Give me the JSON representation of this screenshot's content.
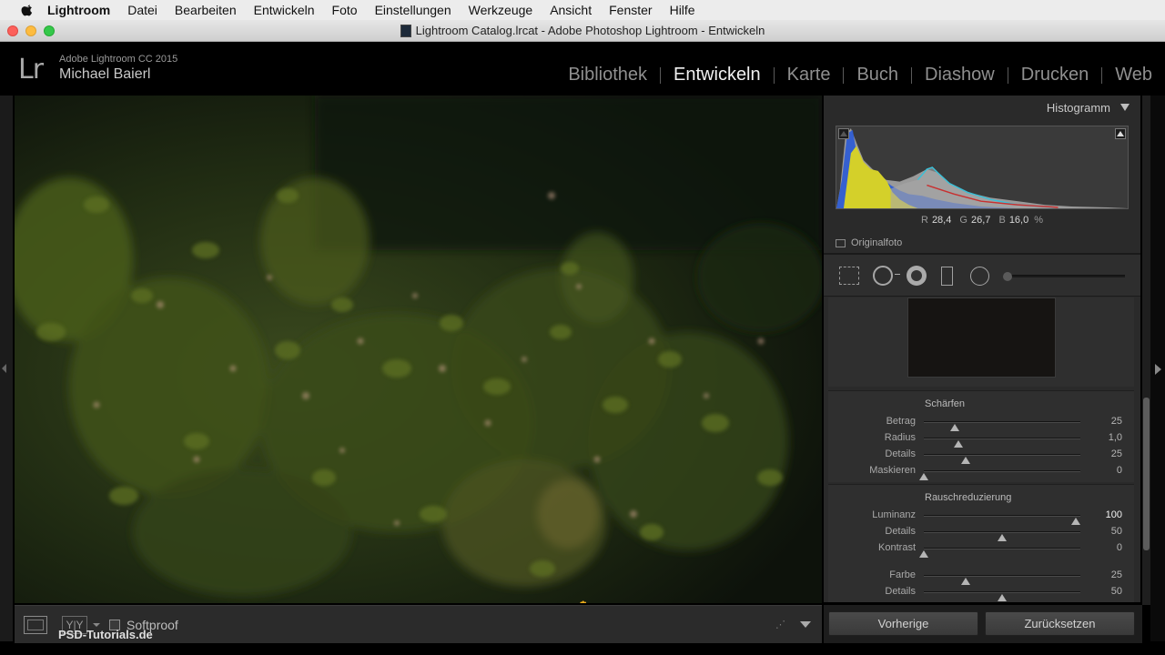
{
  "menubar": {
    "app": "Lightroom",
    "items": [
      "Datei",
      "Bearbeiten",
      "Entwickeln",
      "Foto",
      "Einstellungen",
      "Werkzeuge",
      "Ansicht",
      "Fenster",
      "Hilfe"
    ]
  },
  "window": {
    "title": "Lightroom Catalog.lrcat - Adobe Photoshop Lightroom - Entwickeln"
  },
  "identity": {
    "logo": "Lr",
    "product": "Adobe Lightroom CC 2015",
    "user": "Michael Baierl"
  },
  "modules": {
    "items": [
      "Bibliothek",
      "Entwickeln",
      "Karte",
      "Buch",
      "Diashow",
      "Drucken",
      "Web"
    ],
    "active": "Entwickeln"
  },
  "histogram": {
    "title": "Histogramm",
    "r_label": "R",
    "r_value": "28,4",
    "g_label": "G",
    "g_value": "26,7",
    "b_label": "B",
    "b_value": "16,0",
    "unit": "%",
    "original_label": "Originalfoto"
  },
  "sharpen": {
    "title": "Schärfen",
    "rows": [
      {
        "label": "Betrag",
        "value": "25",
        "pos": 0.2
      },
      {
        "label": "Radius",
        "value": "1,0",
        "pos": 0.22
      },
      {
        "label": "Details",
        "value": "25",
        "pos": 0.27
      },
      {
        "label": "Maskieren",
        "value": "0",
        "pos": 0.0
      }
    ]
  },
  "noise": {
    "title": "Rauschreduzierung",
    "rows": [
      {
        "label": "Luminanz",
        "value": "100",
        "pos": 0.97,
        "highlight": true
      },
      {
        "label": "Details",
        "value": "50",
        "pos": 0.5
      },
      {
        "label": "Kontrast",
        "value": "0",
        "pos": 0.0
      }
    ],
    "color_rows": [
      {
        "label": "Farbe",
        "value": "25",
        "pos": 0.27
      },
      {
        "label": "Details",
        "value": "50",
        "pos": 0.5
      }
    ]
  },
  "toolbar": {
    "softproof_label": "Softproof",
    "watermark": "PSD-Tutorials.de",
    "yy_label": "Y|Y"
  },
  "buttons": {
    "previous": "Vorherige",
    "reset": "Zurücksetzen"
  },
  "colors": {
    "accent_text": "#f0f0f0",
    "panel_bg": "#2a2a2a",
    "hist_yellow": "#d4d02a",
    "hist_blue": "#2a5ad6",
    "hist_cyan": "#3ac0d8"
  }
}
